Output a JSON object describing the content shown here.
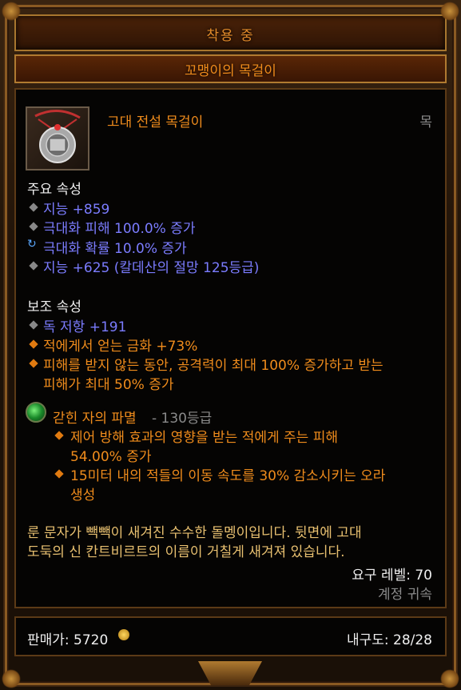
{
  "header": {
    "status": "착용 중",
    "item_name": "꼬맹이의 목걸이"
  },
  "item": {
    "type_name": "고대 전설 목걸이",
    "slot": "목",
    "icon": "amulet-icon"
  },
  "primary": {
    "heading": "주요 속성",
    "stats": [
      {
        "text": "지능 +859",
        "bullet": "diamond"
      },
      {
        "text": "극대화 피해 100.0% 증가",
        "bullet": "diamond"
      },
      {
        "text": "극대화 확률 10.0% 증가",
        "bullet": "cycle"
      },
      {
        "text": "지능 +625 (칼데산의 절망 125등급)",
        "bullet": "diamond"
      }
    ]
  },
  "secondary": {
    "heading": "보조 속성",
    "stats": [
      {
        "text": "독 저항 +191",
        "bullet": "diamond"
      },
      {
        "text": "적에게서 얻는 금화 +73%",
        "bullet": "orange-diamond"
      },
      {
        "line1": "피해를 받지 않는 동안, 공격력이 최대 100% 증가하고 받는",
        "line2": "피해가 최대 50% 증가",
        "bullet": "orange-diamond"
      }
    ]
  },
  "gem": {
    "name": "갇힌 자의 파멸",
    "rank": " - 130등급",
    "effects": [
      {
        "line1": "제어 방해 효과의 영향을 받는 적에게 주는 피해",
        "line2": "54.00% 증가"
      },
      {
        "line1": "15미터 내의 적들의 이동 속도를 30% 감소시키는 오라",
        "line2": "생성"
      }
    ]
  },
  "flavor": {
    "line1": "룬 문자가 빽빽이 새겨진 수수한 돌멩이입니다. 뒷면에 고대",
    "line2": "도둑의 신 칸트비르트의 이름이 거칠게 새겨져 있습니다."
  },
  "requirements": {
    "level": "요구 레벨: 70",
    "binding": "계정 귀속"
  },
  "footer": {
    "sell_label": "판매가: 5720",
    "durability": "내구도: 28/28"
  },
  "colors": {
    "legendary": "#f08c1c",
    "magic": "#7b7cff",
    "frame": "#8a5a22"
  }
}
